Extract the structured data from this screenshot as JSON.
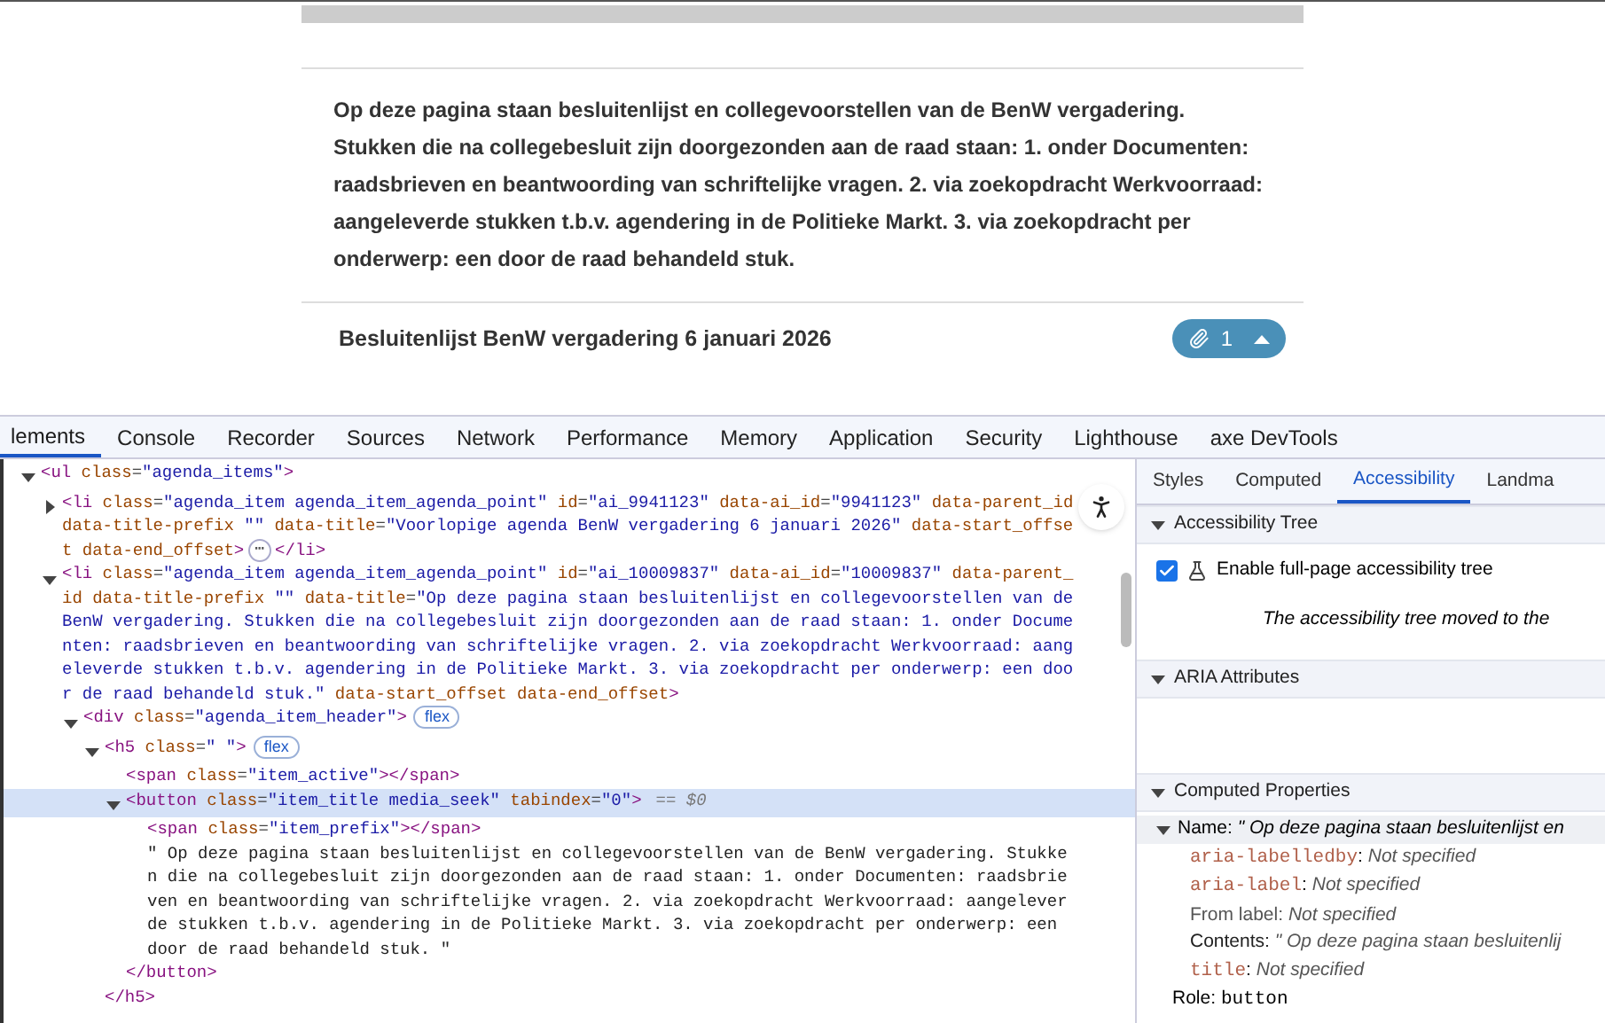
{
  "page": {
    "intro": " Op deze pagina staan besluitenlijst en collegevoorstellen van de BenW vergadering. Stukken die na collegebesluit zijn doorgezonden aan de raad staan: 1. onder Documenten: raadsbrieven en beantwoording van schriftelijke vragen. 2. via zoekopdracht Werkvoorraad: aangeleverde stukken t.b.v. agendering in de Politieke Markt. 3. via zoekopdracht per onderwerp: een door de raad behandeld stuk.",
    "item_title": "Besluitenlijst BenW vergadering 6 januari 2026",
    "attachment_count": "1",
    "expanded": true
  },
  "devtools": {
    "tabs": [
      {
        "label": "lements",
        "selected": true
      },
      {
        "label": "Console",
        "selected": false
      },
      {
        "label": "Recorder",
        "selected": false
      },
      {
        "label": "Sources",
        "selected": false
      },
      {
        "label": "Network",
        "selected": false
      },
      {
        "label": "Performance",
        "selected": false
      },
      {
        "label": "Memory",
        "selected": false
      },
      {
        "label": "Application",
        "selected": false
      },
      {
        "label": "Security",
        "selected": false
      },
      {
        "label": "Lighthouse",
        "selected": false
      },
      {
        "label": "axe DevTools",
        "selected": false
      }
    ],
    "dom_tree": [
      {
        "kind": "element",
        "code": "<ul class=\"agenda_items\">",
        "expanded": true,
        "selected": false,
        "children": [
          {
            "kind": "element",
            "code": "<li class=\"agenda_item agenda_item_agenda_point\" id=\"ai_9941123\" data-ai_id=\"9941123\" data-parent_id data-title-prefix \"\" data-title=\"Voorlopige agenda BenW vergadering 6 januari 2026\" data-start_offset data-end_offset>",
            "ellipsis": "⋯",
            "close": "</li>",
            "expanded": false,
            "selected": false
          },
          {
            "kind": "element",
            "code": "<li class=\"agenda_item agenda_item_agenda_point\" id=\"ai_10009837\" data-ai_id=\"10009837\" data-parent_id data-title-prefix \"\" data-title=\"Op deze pagina staan besluitenlijst en collegevoorstellen van de BenW vergadering. Stukken die na collegebesluit zijn doorgezonden aan de raad staan: 1. onder Documenten: raadsbrieven en beantwoording van schriftelijke vragen. 2. via zoekopdracht Werkvoorraad: aangeleverde stukken t.b.v. agendering in de Politieke Markt. 3. via zoekopdracht per onderwerp: een door de raad behandeld stuk.\" data-start_offset data-end_offset>",
            "expanded": true,
            "selected": false,
            "children": [
              {
                "kind": "element",
                "code": "<div class=\"agenda_item_header\">",
                "badge": "flex",
                "expanded": true,
                "selected": false,
                "children": [
                  {
                    "kind": "element",
                    "code": "<h5 class=\" \">",
                    "badge": "flex",
                    "expanded": true,
                    "selected": false,
                    "children": [
                      {
                        "kind": "element",
                        "code": "<span class=\"item_active\"></span>",
                        "selected": false
                      },
                      {
                        "kind": "element",
                        "code": "<button class=\"item_title media_seek\" tabindex=\"0\">",
                        "suffix": "== $0",
                        "expanded": true,
                        "selected": true,
                        "children": [
                          {
                            "kind": "element",
                            "code": "<span class=\"item_prefix\"></span>",
                            "selected": false
                          },
                          {
                            "kind": "text",
                            "code": "\" Op deze pagina staan besluitenlijst en collegevoorstellen van de BenW vergadering. Stukken die na collegebesluit zijn doorgezonden aan de raad staan: 1. onder Documenten: raadsbrieven en beantwoording van schriftelijke vragen. 2. via zoekopdracht Werkvoorraad: aangeleverde stukken t.b.v. agendering in de Politieke Markt. 3. via zoekopdracht per onderwerp: een door de raad behandeld stuk. \"",
                            "selected": false
                          }
                        ]
                      },
                      {
                        "kind": "close",
                        "code": "</button>",
                        "selected": false
                      }
                    ]
                  },
                  {
                    "kind": "close",
                    "code": "</h5>",
                    "selected": false
                  }
                ]
              }
            ]
          }
        ]
      }
    ],
    "side_tabs": [
      {
        "label": "Styles",
        "selected": false
      },
      {
        "label": "Computed",
        "selected": false
      },
      {
        "label": "Accessibility",
        "selected": true
      },
      {
        "label": "Landma",
        "selected": false
      }
    ],
    "accessibility_tree": {
      "title": "Accessibility Tree",
      "expanded": true,
      "checkbox": {
        "label": "Enable full-page accessibility tree",
        "checked": true
      },
      "note": "The accessibility tree moved to the"
    },
    "aria_attributes": {
      "title": "ARIA Attributes",
      "expanded": true
    },
    "computed_properties": {
      "title": "Computed Properties",
      "expanded": true,
      "name": {
        "label": "Name:",
        "value": "\" Op deze pagina staan besluitenlijst en",
        "expanded": true
      },
      "rows": [
        {
          "kind": "attr",
          "key": "aria-labelledby",
          "sep": ":",
          "value": "Not specified"
        },
        {
          "kind": "attr",
          "key": "aria-label",
          "sep": ":",
          "value": "Not specified"
        },
        {
          "kind": "muted",
          "key": "From label:",
          "value": "Not specified"
        },
        {
          "kind": "plain",
          "key": "Contents:",
          "value": "\" Op deze pagina staan besluitenlij"
        },
        {
          "kind": "attr",
          "key": "title",
          "sep": ":",
          "value": "Not specified"
        }
      ],
      "role": {
        "label": "Role:",
        "value": "button"
      }
    }
  }
}
